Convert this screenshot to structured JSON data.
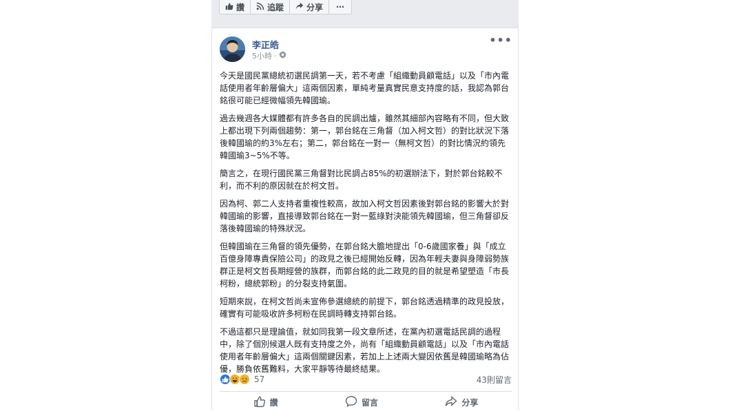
{
  "prev_post_actions": {
    "like_label": "讚",
    "follow_label": "追蹤",
    "share_label": "分享",
    "more_label": "⋯"
  },
  "post": {
    "author": "李正皓",
    "time": "5小時",
    "more_label": "•••",
    "paragraphs": [
      "今天是國民黨總統初選民調第一天，若不考慮「組織動員顧電話」以及「市內電話使用者年齡層偏大」這兩個因素，單純考量真實民意支持度的話，我認為郭台銘很可能已經微幅領先韓國瑜。",
      "過去幾週各大媒體都有許多各自的民調出爐，雖然其細部內容略有不同，但大致上都出現下列兩個趨勢：第一，郭台銘在三角督（加入柯文哲）的對比狀況下落後韓國瑜的約3%左右；第二，郭台銘在一對一（無柯文哲）的對比情況約領先韓國瑜3~5%不等。",
      "簡言之，在現行國民黨三角督對比民調占85%的初選辦法下，對於郭台銘較不利，而不利的原因就在於柯文哲。",
      "因為柯、郭二人支持者重複性較高，故加入柯文哲因素後對郭台銘的影響大於對韓國瑜的影響，直接導致郭台銘在一對一藍綠對決能領先韓國瑜，但三角督卻反落後韓國瑜的特殊狀況。",
      "但韓國瑜在三角督的領先優勢，在郭台銘大膽地提出「0-6歲國家養」與「成立百億身障專責保險公司」的政見之後已經開始反轉，因為年輕夫妻與身障弱勢族群正是柯文哲長期經營的族群，而郭台銘的此二政見的目的就是希望塑造「市長柯粉，總統郭粉」的分裂支持氣圍。",
      "短期來說，在柯文哲尚未宣佈參選總統的前提下，郭台銘透過精準的政見投放，確實有可能吸收許多柯粉在民調時轉支持郭台銘。",
      "不過這都只是理論值，就如同我第一段文章所述，在黨內初選電話民調的過程中，除了個別候選人既有支持度之外，尚有「組織動員顧電話」以及「市內電話使用者年齡層偏大」這兩個關鍵因素，若加上上述兩大變因依舊是韓國瑜略為佔優，勝負依舊難料，大家平靜等待最終結果。"
    ],
    "reaction_count": "57",
    "comments_count": "43則留言",
    "actions": {
      "like_label": "讚",
      "comment_label": "留言",
      "share_label": "分享"
    }
  },
  "colors": {
    "link_blue": "#365899",
    "like_blue": "#1877f2",
    "haha_yellow": "#f7b125",
    "text_gray": "#606770"
  }
}
